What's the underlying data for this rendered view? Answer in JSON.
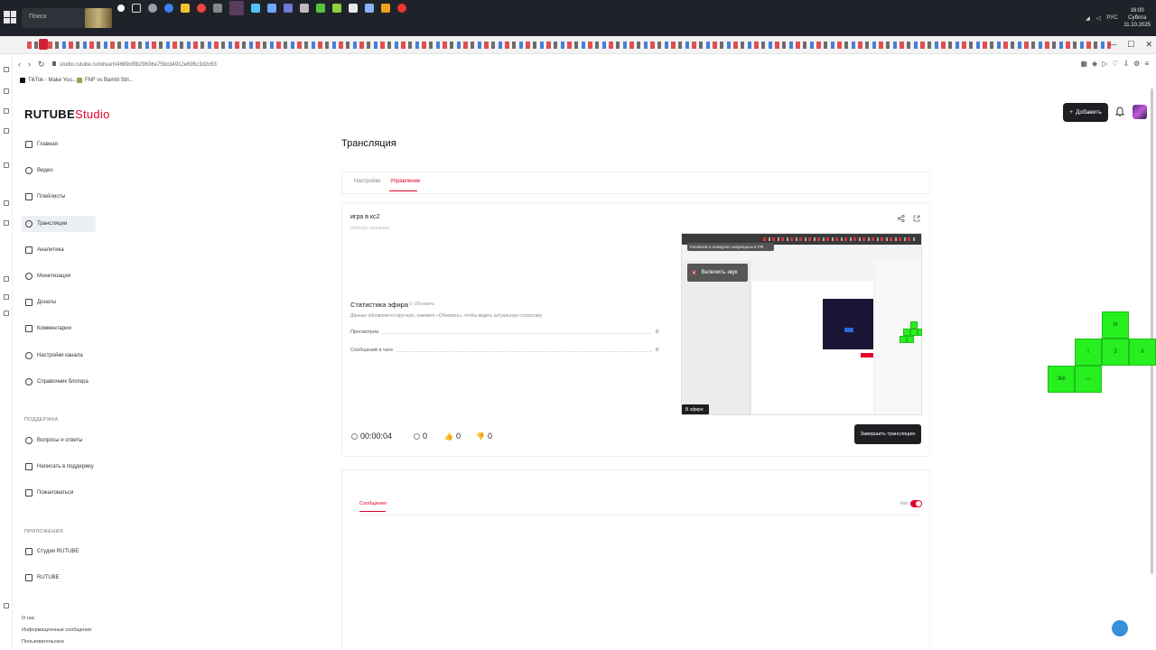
{
  "taskbar": {
    "search_placeholder": "Поиск",
    "clock_time": "16:00",
    "clock_date": "11.10.2025",
    "weather": "11°C",
    "weather_desc": "Cубота",
    "lang": "РУС"
  },
  "browser": {
    "url": "studio.rutube.ru/stream/4689cf8b29636e75bcd4912e695c3d2c63",
    "bookmarks": [
      "TikTok - Make You...",
      "FNF vs Bambi Stri..."
    ]
  },
  "app": {
    "logo_main": "RUTUBE",
    "logo_sub": "Studio",
    "add_button": "Добавить"
  },
  "sidebar": {
    "items": [
      {
        "label": "Главная",
        "icon": "home-icon"
      },
      {
        "label": "Видео",
        "icon": "video-icon"
      },
      {
        "label": "Плейлисты",
        "icon": "playlist-icon"
      },
      {
        "label": "Трансляции",
        "icon": "broadcast-icon"
      },
      {
        "label": "Аналитика",
        "icon": "analytics-icon"
      },
      {
        "label": "Монетизация",
        "icon": "monetization-icon"
      },
      {
        "label": "Донаты",
        "icon": "donate-icon"
      },
      {
        "label": "Комментарии",
        "icon": "comments-icon"
      },
      {
        "label": "Настройки канала",
        "icon": "settings-icon"
      },
      {
        "label": "Справочник блогера",
        "icon": "info-icon"
      }
    ],
    "support_title": "ПОДДЕРЖКА",
    "support_items": [
      {
        "label": "Вопросы и ответы",
        "icon": "question-icon"
      },
      {
        "label": "Написать в поддержку",
        "icon": "mail-icon"
      },
      {
        "label": "Пожаловаться",
        "icon": "flag-icon"
      }
    ],
    "apps_title": "ПРИЛОЖЕНИЯ",
    "apps_items": [
      {
        "label": "Студия RUTUBE",
        "icon": "studio-app-icon"
      },
      {
        "label": "RUTUBE",
        "icon": "rutube-app-icon"
      }
    ],
    "footer": [
      "О нас",
      "Информационные сообщения",
      "Пользовательское"
    ]
  },
  "main": {
    "page_title": "Трансляция",
    "tabs": [
      "Настройки",
      "Управление"
    ],
    "stream_name": "игра в кс2",
    "stream_desc": "Описать описание...",
    "stats_title": "Статистика эфира",
    "refresh_label": "Обновить",
    "stats_hint": "Данные обновляются вручную, нажмите «Обновить», чтобы видеть актуальную статистику",
    "stats": [
      {
        "label": "Просмотров",
        "value": "0"
      },
      {
        "label": "Сообщений в чате",
        "value": "0"
      }
    ],
    "preview": {
      "mute_label": "Включить звук",
      "live_label": "В эфире",
      "overlay_text": "Facebook и Instagram запрещены в РФ"
    },
    "metrics": {
      "duration": "00:00:04",
      "viewers": "0",
      "likes": "0",
      "dislikes": "0"
    },
    "end_button": "Завершить трансляцию",
    "chat_tab": "Сообщения",
    "chat_toggle_label": "Чат"
  },
  "overlay": {
    "labels": [
      "N",
      "i",
      "3",
      "ii",
      "Зkll",
      "—"
    ]
  },
  "colors": {
    "accent": "#e4002b",
    "dark_button": "#1d1f22",
    "overlay_green": "#27ef20"
  }
}
